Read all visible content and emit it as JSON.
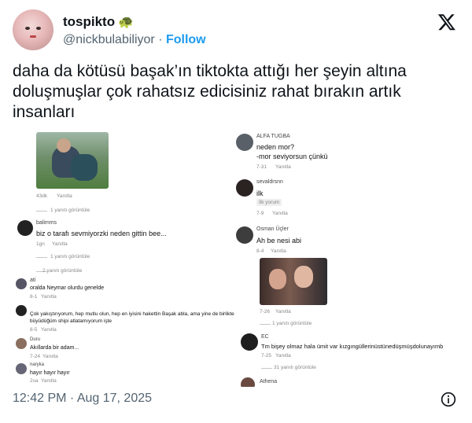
{
  "header": {
    "display_name": "tospikto",
    "name_emoji": "🐢",
    "handle": "@nickbulabiliyor",
    "separator": "·",
    "follow_label": "Follow"
  },
  "tweet": {
    "text": "daha da kötüsü başak’ın tiktokta attığı her şeyin altına doluşmuşlar çok rahatsız edicisiniz rahat bırakın artık insanları"
  },
  "left_panel": {
    "top_meta": "43dk",
    "top_reply": "Yanıtla",
    "view_replies_1": "1 yanıtı görüntüle",
    "c1_name": "balimms",
    "c1_text": "biz o tarafı sevmiyorzki neden gittin bee...",
    "c1_time": "1gn",
    "c1_reply": "Yanıtla",
    "view_replies_2": "1 yanıtı görüntüle",
    "view_replies_3": "2 yanıtı görüntüle",
    "c2_name": "ati",
    "c2_text": "oralda Neymar olurdu genelde",
    "c2_time": "8-1",
    "c2_reply": "Yanıtla",
    "c3_text_1": "Çok yakıştırıyorum, hep mutlu olun, hep en iyisini hakettin Başak abla, ama yine de birlikte",
    "c3_text_2": "büyüdüğüm shipi atlatamıyorum işte",
    "c3_time": "8-5",
    "c3_reply": "Yanıtla",
    "c4_name": "Duru",
    "c4_text": "Akıllarda bir adam...",
    "c4_time": "7-24",
    "c4_reply": "Yanıtla",
    "c5_name": "naryka",
    "c5_text": "hayır hayır hayır",
    "c5_time": "2sa",
    "c5_reply": "Yanıtla"
  },
  "right_panel": {
    "r1_name": "ALFA TUGBA",
    "r1_text_1": "neden mor?",
    "r1_text_2": "-mor seviyorsun çünkü",
    "r1_time": "7-31",
    "r1_reply": "Yanıtla",
    "r2_name": "sevaldrsnn",
    "r2_text": "ilk",
    "r2_badge": "İlk yorum",
    "r2_time": "7-9",
    "r2_reply": "Yanıtla",
    "r3_name": "Osman Üçler",
    "r3_text": "Ah be nesi abi",
    "r3_time": "8-4",
    "r3_reply": "Yanıtla",
    "r3b_time": "7-26",
    "r3b_reply": "Yanıtla",
    "view_replies_r": "1 yanıtı görüntüle",
    "r4_name": "EC",
    "r4_text": "Tm bişey olmaz hala ümit var kızgıngüllerinüstünedüşmüşdolunayımb",
    "r4_time": "7-25",
    "r4_reply": "Yanıtla",
    "view_replies_r2": "31 yanıtı görüntüle",
    "r5_name": "Athena"
  },
  "footer": {
    "timestamp": "12:42 PM · Aug 17, 2025"
  },
  "icons": {
    "x_logo": "x-logo-icon",
    "info": "info-icon"
  }
}
